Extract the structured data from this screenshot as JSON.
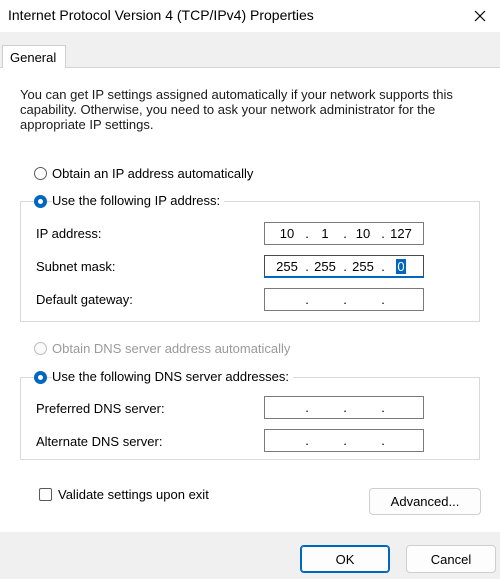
{
  "window": {
    "title": "Internet Protocol Version 4 (TCP/IPv4) Properties",
    "close_icon": "close-icon"
  },
  "tabs": [
    {
      "label": "General",
      "selected": true
    }
  ],
  "general": {
    "description": "You can get IP settings assigned automatically if your network supports this capability. Otherwise, you need to ask your network administrator for the appropriate IP settings.",
    "ip_mode": {
      "auto_label": "Obtain an IP address automatically",
      "manual_label": "Use the following IP address:",
      "selected": "manual"
    },
    "ip_fields": [
      {
        "label": "IP address:",
        "octets": [
          "10",
          "1",
          "10",
          "127"
        ]
      },
      {
        "label": "Subnet mask:",
        "octets": [
          "255",
          "255",
          "255",
          "0"
        ],
        "selected_octet": 3
      },
      {
        "label": "Default gateway:",
        "octets": [
          "",
          "",
          "",
          ""
        ]
      }
    ],
    "dns_mode": {
      "auto_label": "Obtain DNS server address automatically",
      "manual_label": "Use the following DNS server addresses:",
      "selected": "manual",
      "auto_disabled": true
    },
    "dns_fields": [
      {
        "label": "Preferred DNS server:",
        "octets": [
          "",
          "",
          "",
          ""
        ]
      },
      {
        "label": "Alternate DNS server:",
        "octets": [
          "",
          "",
          "",
          ""
        ]
      }
    ],
    "validate_label": "Validate settings upon exit",
    "validate_checked": false,
    "advanced_label": "Advanced..."
  },
  "footer": {
    "ok_label": "OK",
    "cancel_label": "Cancel"
  },
  "colors": {
    "accent": "#0067c0"
  }
}
